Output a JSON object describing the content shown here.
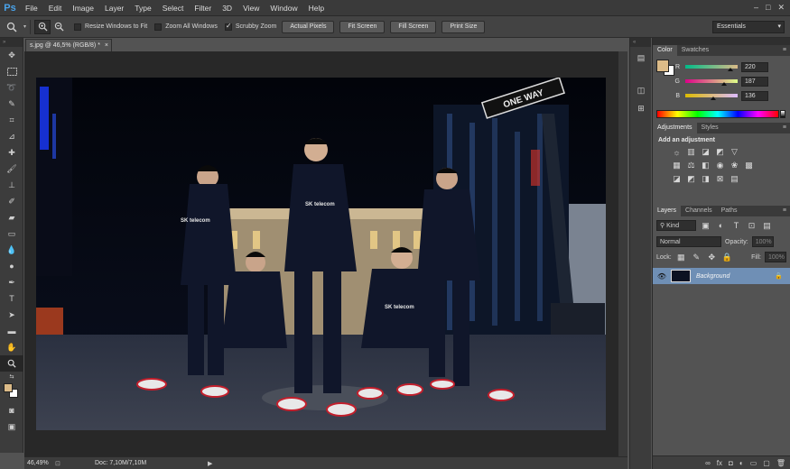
{
  "app": {
    "logo": "Ps"
  },
  "menu": [
    "File",
    "Edit",
    "Image",
    "Layer",
    "Type",
    "Select",
    "Filter",
    "3D",
    "View",
    "Window",
    "Help"
  ],
  "window_controls": {
    "minimize": "–",
    "maximize": "□",
    "close": "✕"
  },
  "options": {
    "tool_icon": "zoom-icon",
    "resize_windows": "Resize Windows to Fit",
    "zoom_all": "Zoom All Windows",
    "scrubby": "Scrubby Zoom",
    "actual_pixels": "Actual Pixels",
    "fit_screen": "Fit Screen",
    "fill_screen": "Fill Screen",
    "print_size": "Print Size",
    "workspace": "Essentials"
  },
  "document": {
    "tab_title": "s.jpg @ 46,5% (RGB/8) *",
    "close": "×"
  },
  "photo": {
    "sign_text": "ONE WAY",
    "jersey_text": "SK telecom"
  },
  "status": {
    "zoom": "46,49%",
    "doc": "Doc: 7,10M/7,10M"
  },
  "color_panel": {
    "tabs": [
      "Color",
      "Swatches"
    ],
    "foreground": "#dcbb88",
    "r_label": "R",
    "g_label": "G",
    "b_label": "B",
    "r": 220,
    "g": 187,
    "b": 136,
    "r_frac": 0.863,
    "g_frac": 0.733,
    "b_frac": 0.533
  },
  "adjustments": {
    "tabs": [
      "Adjustments",
      "Styles"
    ],
    "title": "Add an adjustment"
  },
  "layers": {
    "tabs": [
      "Layers",
      "Channels",
      "Paths"
    ],
    "kind": "Kind",
    "blend": "Normal",
    "opacity_label": "Opacity:",
    "opacity": "100%",
    "lock_label": "Lock:",
    "fill_label": "Fill:",
    "fill": "100%",
    "layer_name": "Background"
  }
}
